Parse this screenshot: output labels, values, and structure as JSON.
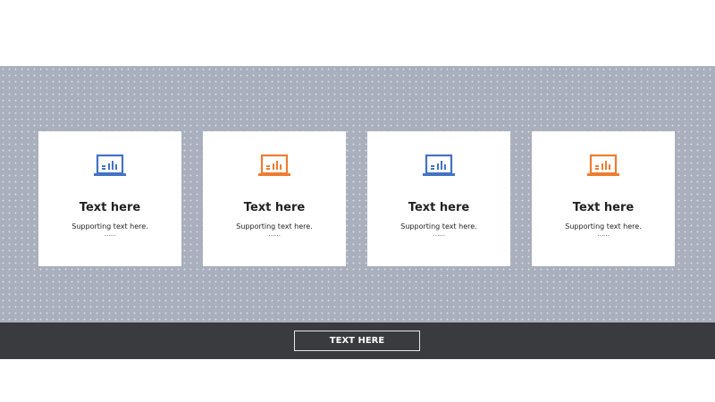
{
  "cards": [
    {
      "icon": "laptop-chart-icon",
      "icon_color": "#4472c4",
      "title": "Text here",
      "subtitle": "Supporting text here.",
      "ellipsis": "……"
    },
    {
      "icon": "laptop-chart-icon",
      "icon_color": "#ed7d31",
      "title": "Text here",
      "subtitle": "Supporting text here.",
      "ellipsis": "……"
    },
    {
      "icon": "laptop-chart-icon",
      "icon_color": "#4472c4",
      "title": "Text here",
      "subtitle": "Supporting text here.",
      "ellipsis": "……"
    },
    {
      "icon": "laptop-chart-icon",
      "icon_color": "#ed7d31",
      "title": "Text here",
      "subtitle": "Supporting text here.",
      "ellipsis": "……"
    }
  ],
  "footer": {
    "button_label": "TEXT HERE"
  },
  "colors": {
    "band": "#a9afbc",
    "footer": "#3a3b3f"
  }
}
